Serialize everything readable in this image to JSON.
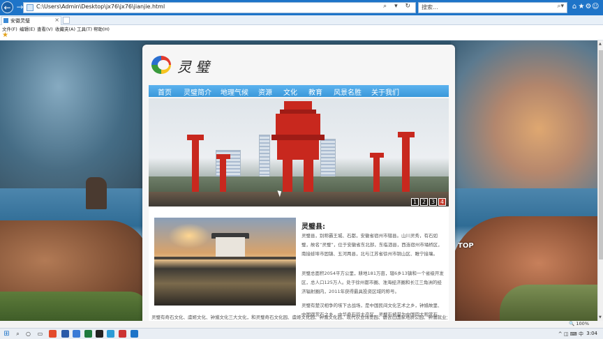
{
  "browser": {
    "address": "C:\\Users\\Admin\\Desktop\\jx76\\jx76\\jianjie.html",
    "address_actions": "⌕ ▾ ↻",
    "search_placeholder": "搜索...",
    "tab_title": "安徽灵璧",
    "menu": [
      "文件(F)",
      "编辑(E)",
      "查看(V)",
      "收藏夹(A)",
      "工具(T)",
      "帮助(H)"
    ],
    "zoom": "🔍 100%"
  },
  "site": {
    "logo_text": "灵璧",
    "nav": [
      "首页",
      "灵璧简介",
      "地理气候",
      "资源",
      "文化",
      "教育",
      "风景名胜",
      "关于我们"
    ],
    "banner_pages": [
      "1",
      "2",
      "3",
      "4"
    ],
    "banner_active_index": 3,
    "article": {
      "title": "灵璧县:",
      "p1": "灵璧县，别称霸王城、石都，安徽省宿州市辖县。山川灵秀，有石如璧，故名“灵璧”，位于安徽省东北部，东临泗县，西连宿州市埇桥区，南接蚌埠市固镇、五河两县，北与江苏省徐州市铜山区、睢宁接壤。",
      "p2": "灵璧总面积2054平方公里，耕地181万亩，辖6乡13镇和一个省级开发区，总人口125万人。处于徐州都市圈、淮海经济圈和长江三角洲的经济辐射圈内，2011年获得最具投资区域的称号。",
      "p3": "灵璧有楚汉相争的垓下古战场，是中国民间文化艺术之乡，钟馗故里、中国观赏石之乡，中华奇石的主产区，灵璧石被誉为中国四大观赏石（灵璧石、太湖石、昆石、英石）之首，素有“虞姬、奇石、钟馗画，灵璧三绝甲天下”之誉。",
      "footer": "灵璧有奇石文化、虞姬文化、钟馗文化三大文化，和灵璧奇石文化园、虞姬文化园、钟馗文化园、现代农业博览园、磬云山国家地质公园、钟馗就业文化园"
    },
    "top_label": "TOP"
  },
  "taskbar": {
    "clock": "3:04",
    "tray": "^ ◫ ⌨ 中"
  },
  "colors": {
    "nav_bar": "#3a98da",
    "address_bar": "#1e74c8",
    "sculpture_red": "#c8281e"
  }
}
